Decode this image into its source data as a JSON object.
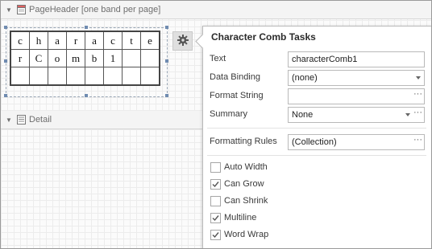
{
  "bands": {
    "page_header": "PageHeader [one band per page]",
    "detail": "Detail"
  },
  "comb": {
    "rows": [
      [
        "c",
        "h",
        "a",
        "r",
        "a",
        "c",
        "t",
        "e"
      ],
      [
        "r",
        "C",
        "o",
        "m",
        "b",
        "1",
        "",
        ""
      ],
      [
        "",
        "",
        "",
        "",
        "",
        "",
        "",
        ""
      ]
    ]
  },
  "panel": {
    "title": "Character Comb Tasks",
    "text_label": "Text",
    "text_value": "characterComb1",
    "binding_label": "Data Binding",
    "binding_value": "(none)",
    "format_label": "Format String",
    "format_value": "",
    "summary_label": "Summary",
    "summary_value": "None",
    "rules_label": "Formatting Rules",
    "rules_value": "(Collection)",
    "ellipsis": "···",
    "checks": [
      {
        "label": "Auto Width",
        "checked": false
      },
      {
        "label": "Can Grow",
        "checked": true
      },
      {
        "label": "Can Shrink",
        "checked": false
      },
      {
        "label": "Multiline",
        "checked": true
      },
      {
        "label": "Word Wrap",
        "checked": true
      }
    ]
  },
  "icons": {
    "collapse": "triangle-down-icon",
    "band": "band-page-icon",
    "smart_tag": "gear-icon",
    "check": "checkmark-icon"
  },
  "colors": {
    "accent_handle": "#6f8bb0",
    "panel_border": "#b9b9b9"
  }
}
